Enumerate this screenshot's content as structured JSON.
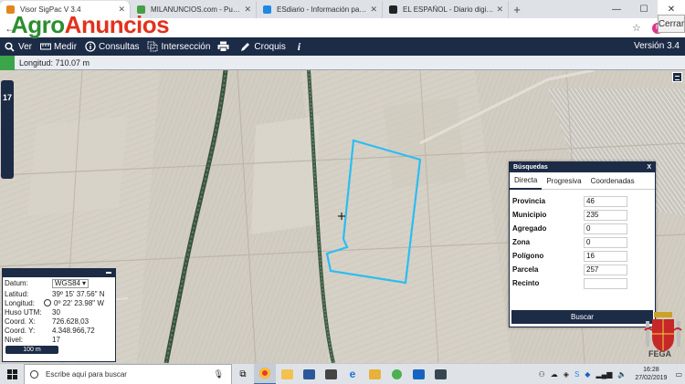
{
  "browser": {
    "tabs": [
      {
        "title": "Visor SigPac V 3.4",
        "color": "#e0861b",
        "active": true
      },
      {
        "title": "MILANUNCIOS.com - Publicar an",
        "color": "#43a047",
        "active": false
      },
      {
        "title": "ESdiario - Información para decid",
        "color": "#1e88e5",
        "active": false
      },
      {
        "title": "EL ESPAÑOL - Diario digital, plur",
        "color": "#222222",
        "active": false
      }
    ],
    "new_tab": "+",
    "tooltip": "Cerrar",
    "profile_initial": "F"
  },
  "watermark": {
    "part1": "Agro",
    "part2": "Anuncios"
  },
  "toolbar": {
    "items": [
      {
        "label": "Ver",
        "icon": "search-icon"
      },
      {
        "label": "Medir",
        "icon": "ruler-icon"
      },
      {
        "label": "Consultas",
        "icon": "info-circle-icon"
      },
      {
        "label": "Intersección",
        "icon": "intersection-icon"
      },
      {
        "label": "",
        "icon": "print-icon"
      },
      {
        "label": "Croquis",
        "icon": "pencil-icon"
      },
      {
        "label": "",
        "icon": "info-italic-icon"
      }
    ],
    "version": "Versión 3.4"
  },
  "length_bar": {
    "text": "Longitud: 710.07 m"
  },
  "map": {
    "zoom_level": "17"
  },
  "search_panel": {
    "title": "Búsquedas",
    "close": "X",
    "tabs": [
      "Directa",
      "Progresiva",
      "Coordenadas"
    ],
    "fields": [
      {
        "label": "Provincia",
        "value": "46"
      },
      {
        "label": "Municipio",
        "value": "235"
      },
      {
        "label": "Agregado",
        "value": "0"
      },
      {
        "label": "Zona",
        "value": "0"
      },
      {
        "label": "Polígono",
        "value": "16"
      },
      {
        "label": "Parcela",
        "value": "257"
      },
      {
        "label": "Recinto",
        "value": ""
      }
    ],
    "button": "Buscar"
  },
  "coords": {
    "datum_label": "Datum:",
    "datum_value": "WGS84",
    "lat_label": "Latitud:",
    "lat_value": "39º 15' 37.56\" N",
    "lon_label": "Longitud:",
    "lon_value": "0º 22' 23.98\" W",
    "huso_label": "Huso UTM:",
    "huso_value": "30",
    "x_label": "Coord. X:",
    "x_value": "726.628,03",
    "y_label": "Coord. Y:",
    "y_value": "4.348.966,72",
    "nivel_label": "Nivel:",
    "nivel_value": "17",
    "scale": "100 m"
  },
  "fega_label": "FEGA",
  "taskbar": {
    "search_placeholder": "Escribe aquí para buscar",
    "time": "16:28",
    "date": "27/02/2019"
  }
}
